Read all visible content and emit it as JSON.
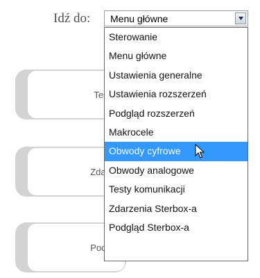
{
  "nav": {
    "label": "Idź do:",
    "selected_value": "Menu główne",
    "options": [
      "Sterowanie",
      "Menu główne",
      "Ustawienia generalne",
      "Ustawienia rozszerzeń",
      "Podgląd rozszerzeń",
      "Makrocele",
      "Obwody cyfrowe",
      "Obwody analogowe",
      "Testy komunikacji",
      "Zdarzenia Sterbox-a",
      "Podgląd Sterbox-a"
    ],
    "highlighted_option": "Obwody cyfrowe"
  },
  "cards": [
    {
      "label": "Testy ko"
    },
    {
      "label": "Zdarzenia"
    },
    {
      "label": "Podgląd"
    }
  ],
  "colors": {
    "highlight": "#3399ff",
    "card_frame": "#d3d3d3"
  }
}
